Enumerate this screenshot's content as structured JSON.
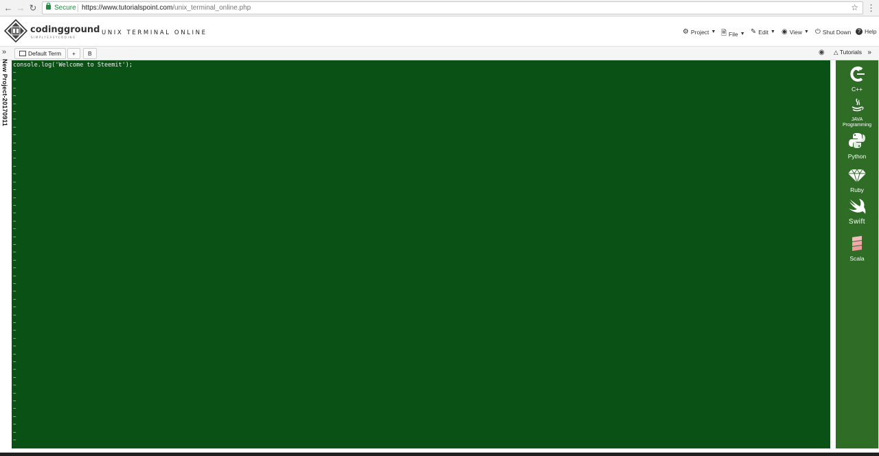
{
  "browser": {
    "secure_label": "Secure",
    "url_host": "https://www.tutorialspoint.com",
    "url_path": "/unix_terminal_online.php",
    "icons": [
      "back-icon",
      "forward-icon",
      "reload-icon",
      "star-icon",
      "menu-icon"
    ]
  },
  "header": {
    "logo_name": "codingground",
    "logo_tagline": "SIMPLYEASYCODING",
    "app_title": "UNIX TERMINAL ONLINE",
    "menu": [
      {
        "label": "Project",
        "icon": "gear-icon"
      },
      {
        "label": "File",
        "icon": "file-icon"
      },
      {
        "label": "Edit",
        "icon": "edit-icon"
      },
      {
        "label": "View",
        "icon": "eye-icon"
      },
      {
        "label": "Shut Down",
        "icon": "power-icon"
      },
      {
        "label": "Help",
        "icon": "help-icon"
      }
    ]
  },
  "toolbar": {
    "tab_default": "Default Term",
    "tab_add": "+",
    "tab_b": "B",
    "tutorials_label": "Tutorials"
  },
  "sidebar": {
    "project_name": "New Project-20170911"
  },
  "terminal": {
    "first_line": "console.log('Welcome to Steemit');",
    "empty_line_marker": "~",
    "background_color": "#0a5115"
  },
  "tutorials": {
    "items": [
      {
        "label": "C++",
        "icon": "cpp-icon"
      },
      {
        "label": "JAVA Programming",
        "icon": "java-icon"
      },
      {
        "label": "Python",
        "icon": "python-icon"
      },
      {
        "label": "Ruby",
        "icon": "ruby-icon"
      },
      {
        "label": "Swift",
        "icon": "swift-icon"
      },
      {
        "label": "Scala",
        "icon": "scala-icon"
      }
    ]
  }
}
